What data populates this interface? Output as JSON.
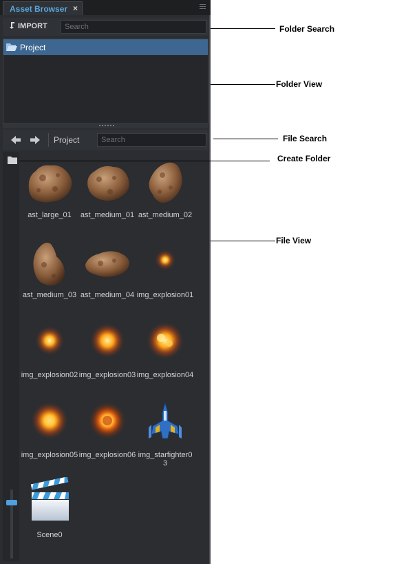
{
  "window": {
    "tab_title": "Asset Browser",
    "tab_close": "×"
  },
  "folder_toolbar": {
    "import_label": "IMPORT",
    "search_placeholder": "Search"
  },
  "folder_view": {
    "items": [
      {
        "label": "Project",
        "selected": true
      }
    ]
  },
  "file_toolbar": {
    "breadcrumb": "Project",
    "search_placeholder": "Search"
  },
  "file_view": {
    "items": [
      {
        "label": "ast_large_01",
        "icon": "asteroid-large-icon"
      },
      {
        "label": "ast_medium_01",
        "icon": "asteroid-medium-icon"
      },
      {
        "label": "ast_medium_02",
        "icon": "asteroid-medium-icon"
      },
      {
        "label": "ast_medium_03",
        "icon": "asteroid-medium-icon"
      },
      {
        "label": "ast_medium_04",
        "icon": "asteroid-medium-icon"
      },
      {
        "label": "img_explosion01",
        "icon": "explosion-icon"
      },
      {
        "label": "img_explosion02",
        "icon": "explosion-icon"
      },
      {
        "label": "img_explosion03",
        "icon": "explosion-icon"
      },
      {
        "label": "img_explosion04",
        "icon": "explosion-icon"
      },
      {
        "label": "img_explosion05",
        "icon": "explosion-icon"
      },
      {
        "label": "img_explosion06",
        "icon": "explosion-icon"
      },
      {
        "label": "img_starfighter03",
        "icon": "starfighter-icon"
      },
      {
        "label": "Scene0",
        "icon": "clapperboard-icon"
      }
    ]
  },
  "callouts": {
    "folder_search": "Folder Search",
    "folder_view": "Folder View",
    "file_search": "File Search",
    "create_folder": "Create Folder",
    "file_view": "File View"
  },
  "colors": {
    "panel_bg": "#2b2d30",
    "accent": "#5ba6dd",
    "selection": "#3d6690"
  }
}
